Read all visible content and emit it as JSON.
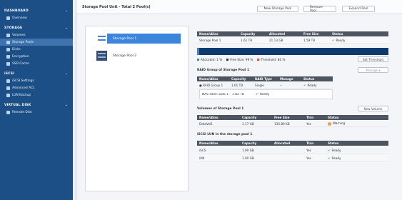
{
  "sidebar": {
    "sections": [
      {
        "label": "DASHBOARD",
        "items": [
          {
            "label": "Overview",
            "icon": "overview-icon"
          }
        ]
      },
      {
        "label": "STORAGE",
        "items": [
          {
            "label": "Volumes",
            "icon": "volume-icon"
          },
          {
            "label": "Storage Pools",
            "icon": "pool-icon",
            "active": true
          },
          {
            "label": "Disks",
            "icon": "disk-icon"
          },
          {
            "label": "Encryption",
            "icon": "key-icon"
          },
          {
            "label": "SSD Cache",
            "icon": "cache-icon"
          }
        ]
      },
      {
        "label": "iSCSI",
        "items": [
          {
            "label": "iSCSI Settings",
            "icon": "network-icon"
          },
          {
            "label": "Advanced ACL",
            "icon": "acl-icon"
          },
          {
            "label": "LUN Backup",
            "icon": "backup-icon"
          }
        ]
      },
      {
        "label": "VIRTUAL DISK",
        "items": [
          {
            "label": "Remote Disk",
            "icon": "remote-disk-icon"
          }
        ]
      }
    ]
  },
  "toolbar": {
    "title": "Storage Pool Unit - Total 2 Pool(s)",
    "new_label": "New Storage Pool",
    "remove_label": "Remove Pool",
    "expand_label": "Expand Pool"
  },
  "pools": [
    {
      "label": "Storage Pool 1",
      "selected": true
    },
    {
      "label": "Storage Pool 2",
      "selected": false
    }
  ],
  "pool_table": {
    "headers": [
      "Name/Alias",
      "Capacity",
      "Allocated",
      "Free Size",
      "Status"
    ],
    "rows": [
      [
        "Storage Pool 1",
        "1.61 TB",
        "21.13 GB",
        "1.59 TB",
        "Ready"
      ]
    ]
  },
  "capacity": {
    "allocated_pct": 1,
    "legend": [
      "Allocated: 1 %",
      "Free Size: 99 %",
      "Threshold: 80 %"
    ],
    "threshold_btn": "Set Threshold"
  },
  "raid": {
    "title": "RAID Group of Storage Pool 1",
    "manage": "Manage",
    "headers": [
      "Name/Alias",
      "Capacity",
      "RAID Type",
      "Manage",
      "Status"
    ],
    "group": [
      "RAID Group 1",
      "1.61 TB",
      "Single",
      "--",
      "Ready"
    ],
    "disk": [
      "NAS Host: Disk 1",
      "1.82 TB",
      "Ready"
    ]
  },
  "volumes": {
    "title": "Volumes of Storage Pool 1",
    "new_btn": "New Volume",
    "headers": [
      "Name/Alias",
      "Capacity",
      "Free Size",
      "Thin",
      "Status"
    ],
    "rows": [
      [
        "DataVol1",
        "1.17 GB",
        "135.89 KB",
        "Yes",
        "Warning"
      ]
    ]
  },
  "lun": {
    "title": "iSCSI LUN in the storage pool 1",
    "headers": [
      "Name/Alias",
      "Capacity",
      "Allocated",
      "Thin",
      "Status"
    ],
    "rows": [
      [
        "iSCS",
        "1.00 GB",
        "",
        "Yes",
        "Ready"
      ],
      [
        "lUN",
        "1.00 GB",
        "",
        "Yes",
        "Ready"
      ]
    ]
  }
}
